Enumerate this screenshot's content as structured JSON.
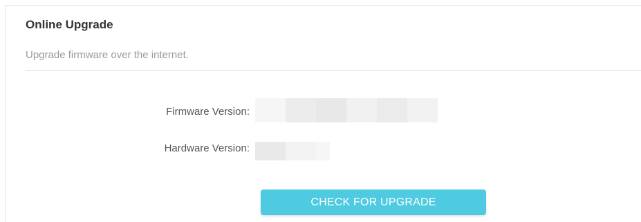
{
  "section": {
    "title": "Online Upgrade",
    "description": "Upgrade firmware over the internet."
  },
  "fields": {
    "firmware": {
      "label": "Firmware Version:",
      "value": ""
    },
    "hardware": {
      "label": "Hardware Version:",
      "value": ""
    }
  },
  "actions": {
    "check_label": "CHECK FOR UPGRADE"
  },
  "colors": {
    "accent": "#4ecbe0",
    "border": "#dcdcdc",
    "title": "#333333",
    "muted": "#999999"
  }
}
